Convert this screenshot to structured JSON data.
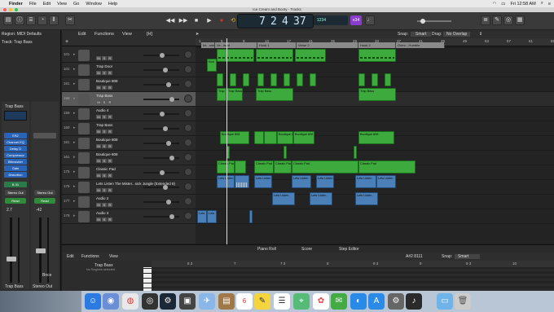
{
  "menubar": {
    "apple": "",
    "items": [
      "Finder",
      "File",
      "Edit",
      "View",
      "Go",
      "Window",
      "Help"
    ],
    "time": "Fri 12:58 AM"
  },
  "window": {
    "title": "Ice Cream and Booty - Tracks"
  },
  "control": {
    "lcd_bar": "7",
    "lcd_beat": "2",
    "lcd_div": "4",
    "lcd_tick": "37",
    "mini_text": "1234",
    "cpu_badge": "≡34",
    "transport": {
      "rewind": "◀◀",
      "forward": "▶▶",
      "stop": "■",
      "play": "▶",
      "record": "●",
      "cycle": "⟲"
    }
  },
  "inspector": {
    "region_label": "Region: MIDI Defaults",
    "track_label": "Track: Trap Bass",
    "channel_name": "Trap Bass",
    "eq_label": "EQ",
    "plugins": [
      "ES2",
      "Channel EQ",
      "Delay D",
      "Compressor",
      "Bitcrusher",
      "Gain",
      "Distortion"
    ],
    "send_label": "B 31",
    "output": "Stereo Out",
    "read_label": "Read",
    "left_value": "2.7",
    "right_value": "-42",
    "bounce": "Bnce",
    "name_left": "Trap Bass",
    "name_right": "Stereo Out"
  },
  "tracks_header": {
    "edit": "Edit",
    "functions": "Functions",
    "view": "View",
    "h": "[H]"
  },
  "tracks": [
    {
      "num": "101",
      "name": "",
      "sel": false
    },
    {
      "num": "101",
      "name": "Trap Door",
      "sel": false
    },
    {
      "num": "161",
      "name": "Boutique 808",
      "sel": false
    },
    {
      "num": "158",
      "name": "Trap Bass",
      "sel": true
    },
    {
      "num": "159",
      "name": "Audio 4",
      "sel": false
    },
    {
      "num": "160",
      "name": "Trap Bass",
      "sel": false
    },
    {
      "num": "161",
      "name": "Boutique 808",
      "sel": false
    },
    {
      "num": "161",
      "name": "Boutique 808",
      "sel": false
    },
    {
      "num": "175",
      "name": "Classic Pad",
      "sel": false
    },
    {
      "num": "176",
      "name": "Lets Listen The Mister...sick Jungle (Extended 8)",
      "sel": false
    },
    {
      "num": "177",
      "name": "Audio 2",
      "sel": false
    },
    {
      "num": "178",
      "name": "Audio 3",
      "sel": false
    }
  ],
  "edit_toolbar": {
    "snap_label": "Snap:",
    "snap_value": "Smart",
    "drag_label": "Drag:",
    "drag_value": "No Overlap"
  },
  "ruler": [
    "1",
    "5",
    "9",
    "13",
    "17",
    "21",
    "25",
    "29",
    "33",
    "37",
    "41",
    "45",
    "49",
    "53",
    "57",
    "61",
    "65"
  ],
  "markers": [
    "Int...ude",
    "Ve...isaid",
    "Hook 1",
    "Verse 2",
    "Hook 2",
    "Outro - Humble"
  ],
  "regions": {
    "trap_door": "Trap Door",
    "kick": "Kick",
    "boutique": "Boutique 808",
    "trap_bass": "Trap Bass",
    "classic_pad": "Classic Pad",
    "lets_listen": "Lets Listen",
    "lots": "Lots"
  },
  "editor": {
    "tabs": [
      "Piano Roll",
      "Score",
      "Step Editor"
    ],
    "edit": "Edit",
    "functions": "Functions",
    "view": "View",
    "region_name": "Trap Bass",
    "region_sub": "No Regions selected",
    "position": "A#2  8111",
    "snap_label": "Snap:",
    "snap_value": "Smart",
    "ruler": [
      "6 3",
      "7",
      "7 3",
      "8",
      "8 3",
      "9",
      "9 3",
      "10"
    ]
  },
  "colors": {
    "green_region": "#3daa3d",
    "blue_region": "#4a7fb8",
    "record": "#e03030",
    "cpu": "#8a3ccf"
  }
}
